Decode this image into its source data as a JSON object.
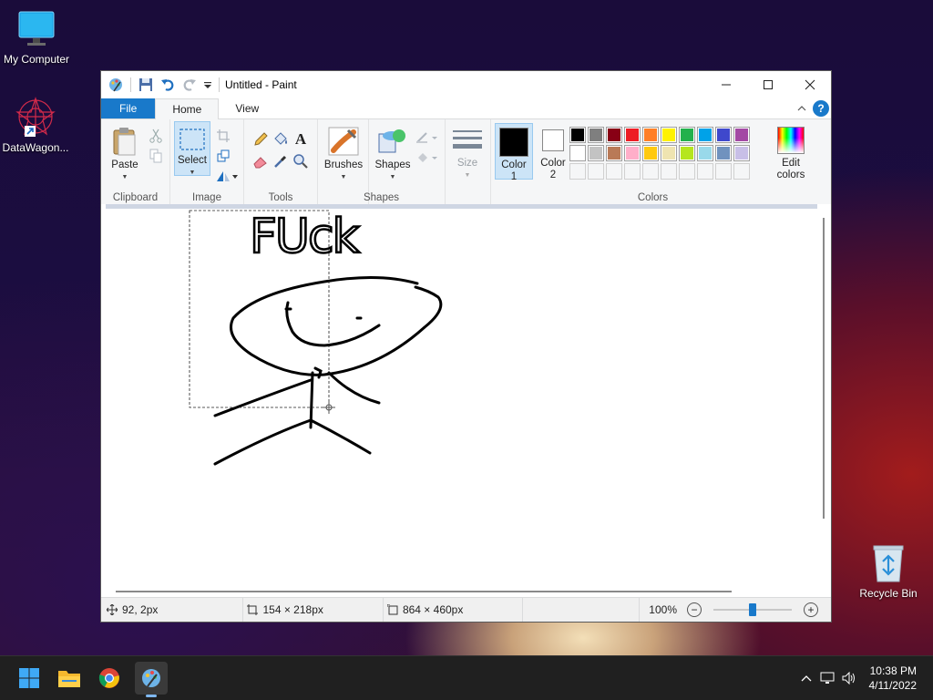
{
  "desktop": {
    "icons": [
      {
        "label": "My Computer"
      },
      {
        "label": "DataWagon..."
      },
      {
        "label": "Recycle Bin"
      }
    ]
  },
  "window": {
    "title": "Untitled - Paint",
    "tabs": [
      "File",
      "Home",
      "View"
    ],
    "help": "?"
  },
  "ribbon": {
    "clipboard": {
      "paste": "Paste",
      "label": "Clipboard"
    },
    "image": {
      "select": "Select",
      "label": "Image"
    },
    "tools": {
      "label": "Tools",
      "text_tool": "A"
    },
    "shapes": {
      "brushes": "Brushes",
      "shapes": "Shapes",
      "label": "Shapes"
    },
    "size": {
      "label": "Size"
    },
    "colors": {
      "color1_line1": "Color",
      "color1_line2": "1",
      "color2_line1": "Color",
      "color2_line2": "2",
      "edit_line1": "Edit",
      "edit_line2": "colors",
      "label": "Colors",
      "color1": "#000000",
      "color2": "#ffffff",
      "palette_row1": [
        "#000000",
        "#7f7f7f",
        "#880015",
        "#ed1c24",
        "#ff7f27",
        "#fff200",
        "#22b14c",
        "#00a2e8",
        "#3f48cc",
        "#a349a4"
      ],
      "palette_row2": [
        "#ffffff",
        "#c3c3c3",
        "#b97a57",
        "#ffaec9",
        "#ffc90e",
        "#efe4b0",
        "#b5e61d",
        "#99d9ea",
        "#7092be",
        "#c8bfe7"
      ]
    }
  },
  "canvas": {
    "drawn_text": "FUck"
  },
  "status": {
    "cursor_pos": "92, 2px",
    "selection_size": "154 × 218px",
    "image_size": "864 × 460px",
    "zoom": "100%",
    "zoom_fraction": 0.5
  },
  "taskbar": {
    "time": "10:38 PM",
    "date": "4/11/2022"
  }
}
